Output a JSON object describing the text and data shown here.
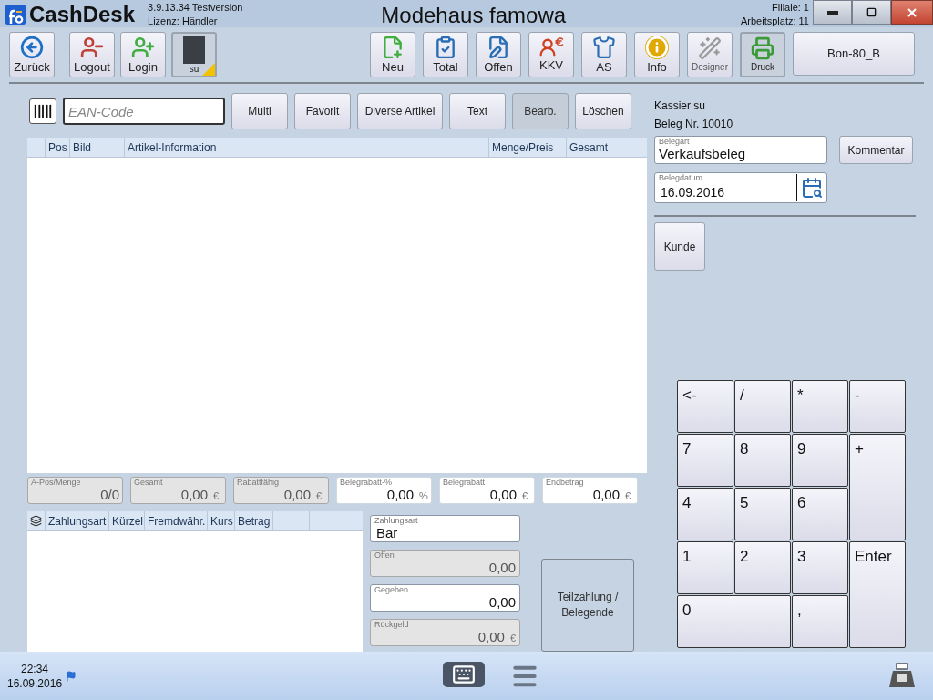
{
  "app": {
    "name": "CashDesk",
    "version": "3.9.13.34 Testversion",
    "license": "Lizenz: Händler",
    "title": "Modehaus famowa",
    "branch": "Filiale: 1",
    "workstation": "Arbeitsplatz: 11"
  },
  "toolbar": [
    {
      "kind": "back",
      "label": "Zurück",
      "active": false,
      "disabled": false
    },
    {
      "kind": "logout",
      "label": "Logout",
      "active": false,
      "disabled": false
    },
    {
      "kind": "login",
      "label": "Login",
      "active": false,
      "disabled": false
    },
    {
      "kind": "user",
      "label": "su",
      "active": true,
      "disabled": false
    },
    {
      "kind": "new",
      "label": "Neu",
      "active": false,
      "disabled": false
    },
    {
      "kind": "total",
      "label": "Total",
      "active": false,
      "disabled": false
    },
    {
      "kind": "open",
      "label": "Offen",
      "active": false,
      "disabled": false
    },
    {
      "kind": "kkv",
      "label": "KKV",
      "active": false,
      "disabled": false
    },
    {
      "kind": "as",
      "label": "AS",
      "active": false,
      "disabled": false
    },
    {
      "kind": "info",
      "label": "Info",
      "active": false,
      "disabled": false
    },
    {
      "kind": "designer",
      "label": "Designer",
      "active": false,
      "disabled": true
    },
    {
      "kind": "print",
      "label": "Druck",
      "active": true,
      "disabled": false
    },
    {
      "kind": "printer",
      "label": "Bon-80_B",
      "active": false,
      "disabled": false
    }
  ],
  "scan": {
    "placeholder": "EAN-Code",
    "buttons": [
      {
        "label": "Multi",
        "disabled": false
      },
      {
        "label": "Favorit",
        "disabled": false
      },
      {
        "label": "Diverse Artikel",
        "disabled": false
      },
      {
        "label": "Text",
        "disabled": false
      },
      {
        "label": "Bearb.",
        "disabled": true
      },
      {
        "label": "Löschen",
        "disabled": false
      }
    ]
  },
  "items_table": {
    "columns": [
      "Pos",
      "Bild",
      "Artikel-Information",
      "Menge/Preis",
      "Gesamt"
    ]
  },
  "totals": [
    {
      "label": "A-Pos/Menge",
      "value": "0/0",
      "editable": false
    },
    {
      "label": "Gesamt",
      "value": "0,00",
      "unit": "€",
      "editable": false
    },
    {
      "label": "Rabattfähig",
      "value": "0,00",
      "unit": "€",
      "editable": false
    },
    {
      "label": "Belegrabatt-%",
      "value": "0,00",
      "unit": "%",
      "editable": true
    },
    {
      "label": "Belegrabatt",
      "value": "0,00",
      "unit": "€",
      "editable": true
    },
    {
      "label": "Endbetrag",
      "value": "0,00",
      "unit": "€",
      "editable": true
    }
  ],
  "payments_table": {
    "columns": [
      "Zahlungsart",
      "Kürzel",
      "Fremdwähr.",
      "Kurs",
      "Betrag"
    ]
  },
  "payment_fields": [
    {
      "kind": "select",
      "label": "Zahlungsart",
      "value": "Bar",
      "editable": true
    },
    {
      "kind": "amount",
      "label": "Offen",
      "value": "0,00",
      "editable": false
    },
    {
      "kind": "amount",
      "label": "Gegeben",
      "value": "0,00",
      "editable": true
    },
    {
      "kind": "amount",
      "label": "Rückgeld",
      "value": "0,00",
      "unit": "€",
      "editable": false
    }
  ],
  "finish_button": "Teilzahlung / Belegende",
  "receipt": {
    "cashier": "Kassier su",
    "number": "Beleg Nr. 10010",
    "type_label": "Belegart",
    "type_value": "Verkaufsbeleg",
    "comment_button": "Kommentar",
    "date_label": "Belegdatum",
    "date_value": "16.09.2016",
    "customer_button": "Kunde"
  },
  "keypad": [
    {
      "label": "<-",
      "kind": "normal"
    },
    {
      "label": "/",
      "kind": "normal"
    },
    {
      "label": "*",
      "kind": "normal"
    },
    {
      "label": "-",
      "kind": "normal"
    },
    {
      "label": "7",
      "kind": "normal"
    },
    {
      "label": "8",
      "kind": "normal"
    },
    {
      "label": "9",
      "kind": "normal"
    },
    {
      "label": "+",
      "kind": "tall"
    },
    {
      "label": "4",
      "kind": "normal"
    },
    {
      "label": "5",
      "kind": "normal"
    },
    {
      "label": "6",
      "kind": "normal"
    },
    {
      "label": "1",
      "kind": "normal"
    },
    {
      "label": "2",
      "kind": "normal"
    },
    {
      "label": "3",
      "kind": "normal"
    },
    {
      "label": "Enter",
      "kind": "tall"
    },
    {
      "label": "0",
      "kind": "wide"
    },
    {
      "label": ",",
      "kind": "normal"
    }
  ],
  "taskbar": {
    "time": "22:34",
    "date": "16.09.2016"
  }
}
